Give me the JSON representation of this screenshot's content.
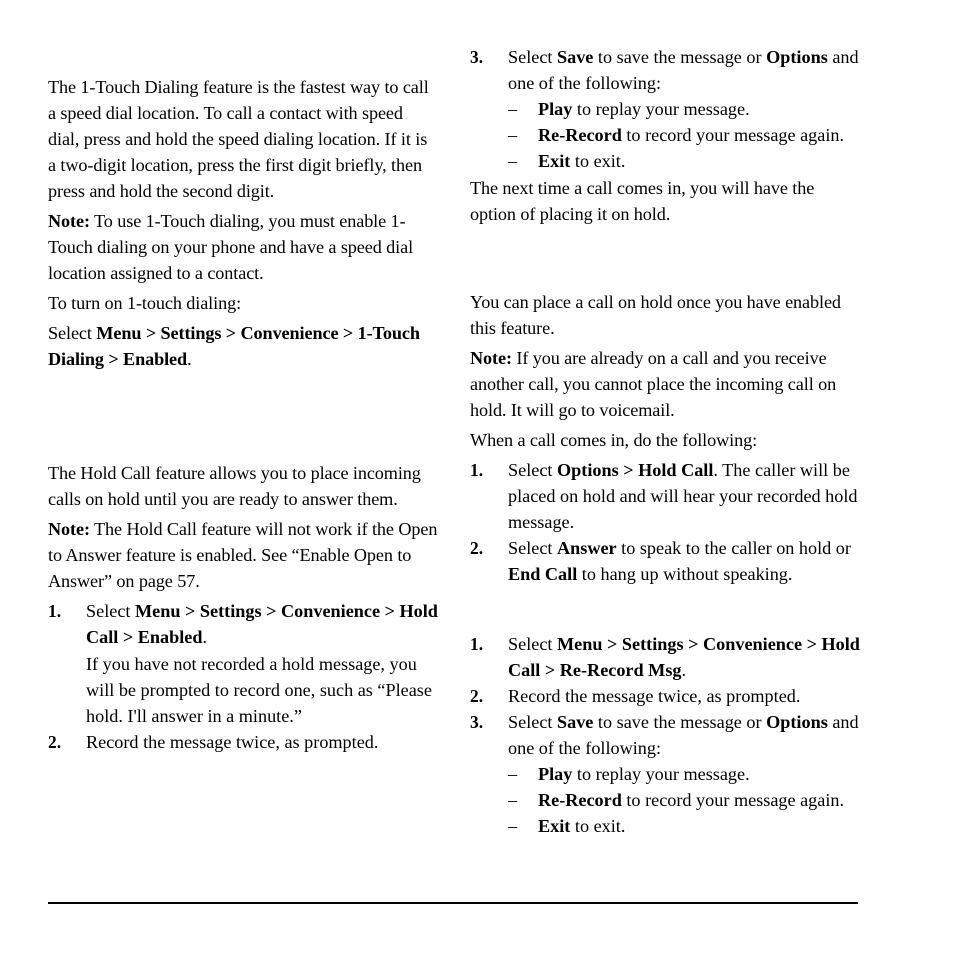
{
  "document": {
    "type": "user-manual-page",
    "columns": 2
  },
  "left_column": {
    "one_touch": {
      "intro": "The 1-Touch Dialing feature is the fastest way to call a speed dial location. To call a contact with speed dial, press and hold the speed dialing location. If it is a two-digit location, press the first digit briefly, then press and hold the second digit.",
      "note_label": "Note:",
      "note_text": " To use 1-Touch dialing, you must enable 1-Touch dialing on your phone and have a speed dial location assigned to a contact.",
      "lead_in": "To turn on 1-touch dialing:",
      "select_prefix": "Select ",
      "select_path": "Menu > Settings > Convenience > 1-Touch Dialing > Enabled",
      "select_suffix": "."
    },
    "hold_call": {
      "intro": "The Hold Call feature allows you to place incoming calls on hold until you are ready to answer them.",
      "note_label": "Note:",
      "note_text": " The Hold Call feature will not work if the Open to Answer feature is enabled. See “Enable Open to Answer” on page 57.",
      "steps": [
        {
          "num": "1.",
          "prefix": "Select ",
          "bold": "Menu > Settings > Convenience > Hold Call > Enabled",
          "suffix": ".",
          "sub": "If you have not recorded a hold message, you will be prompted to record one, such as “Please hold. I'll answer in a minute.”"
        },
        {
          "num": "2.",
          "prefix": "Record the message twice, as prompted.",
          "bold": "",
          "suffix": "",
          "sub": ""
        }
      ]
    }
  },
  "right_column": {
    "record_msg_top": {
      "step": {
        "num": "3.",
        "p1": "Select ",
        "b1": "Save",
        "p2": " to save the message or ",
        "b2": "Options",
        "p3": " and one of the following:"
      },
      "options": [
        {
          "dash": "–",
          "bold": "Play",
          "text": " to replay your message."
        },
        {
          "dash": "–",
          "bold": "Re-Record",
          "text": " to record your message again."
        },
        {
          "dash": "–",
          "bold": "Exit",
          "text": " to exit."
        }
      ],
      "closing": "The next time a call comes in, you will have the option of placing it on hold."
    },
    "place_on_hold": {
      "intro": "You can place a call on hold once you have enabled this feature.",
      "note_label": "Note:",
      "note_text": " If you are already on a call and you receive another call, you cannot place the incoming call on hold. It will go to voicemail.",
      "lead_in": "When a call comes in, do the following:",
      "steps": [
        {
          "num": "1.",
          "p1": "Select ",
          "b1": "Options > Hold Call",
          "p2": ". The caller will be placed on hold and will hear your recorded hold message."
        },
        {
          "num": "2.",
          "p1": "Select ",
          "b1": "Answer",
          "p2": " to speak to the caller on hold or ",
          "b2": "End Call",
          "p3": " to hang up without speaking."
        }
      ]
    },
    "rerecord_msg": {
      "steps": [
        {
          "num": "1.",
          "p1": "Select ",
          "b1": "Menu  > Settings > Convenience > Hold Call > Re-Record Msg",
          "p2": "."
        },
        {
          "num": "2.",
          "p1": "Record the message twice, as prompted.",
          "b1": "",
          "p2": ""
        },
        {
          "num": "3.",
          "p1": "Select ",
          "b1": "Save",
          "p2": " to save the message or ",
          "b2": "Options",
          "p3": " and one of the following:"
        }
      ],
      "options": [
        {
          "dash": "–",
          "bold": "Play",
          "text": " to replay your message."
        },
        {
          "dash": "–",
          "bold": "Re-Record",
          "text": " to record your message again."
        },
        {
          "dash": "–",
          "bold": "Exit",
          "text": " to exit."
        }
      ]
    }
  }
}
